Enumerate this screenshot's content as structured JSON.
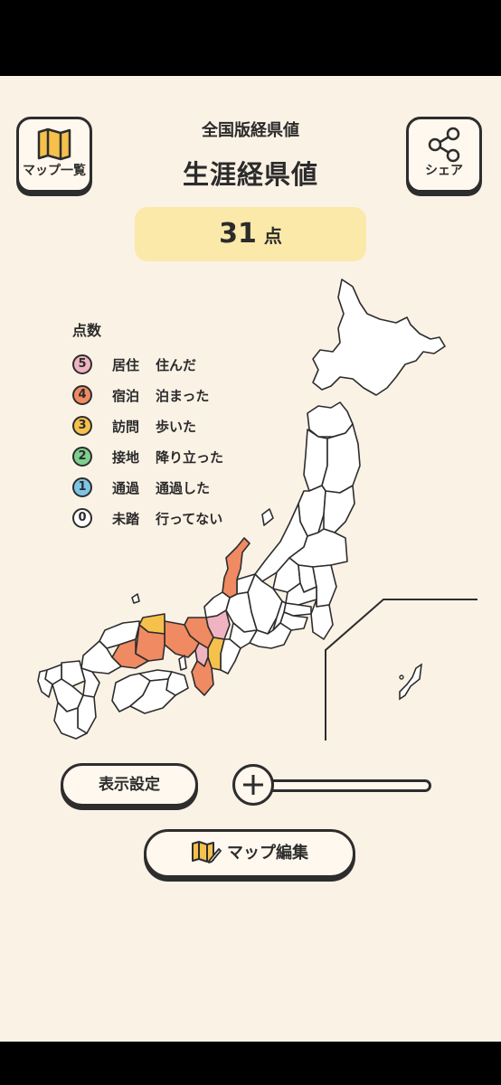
{
  "header": {
    "map_list_label": "マップ一覧",
    "share_label": "シェア",
    "subtitle": "全国版経県値",
    "title": "生涯経県値"
  },
  "score": {
    "value": "31",
    "unit": "点"
  },
  "legend": {
    "title": "点数",
    "levels": [
      {
        "score": "5",
        "name": "居住",
        "desc": "住んだ",
        "color": "#f0b3c2"
      },
      {
        "score": "4",
        "name": "宿泊",
        "desc": "泊まった",
        "color": "#f08a62"
      },
      {
        "score": "3",
        "name": "訪問",
        "desc": "歩いた",
        "color": "#f5c14c"
      },
      {
        "score": "2",
        "name": "接地",
        "desc": "降り立った",
        "color": "#7fcf8e"
      },
      {
        "score": "1",
        "name": "通過",
        "desc": "通過した",
        "color": "#7ec4e4"
      },
      {
        "score": "0",
        "name": "未踏",
        "desc": "行ってない",
        "color": "#ffffff"
      }
    ]
  },
  "controls": {
    "display_settings_label": "表示設定",
    "map_edit_label": "マップ編集",
    "zoom_icon": "plus-icon"
  },
  "colors": {
    "background": "#fbf2e6",
    "score_box": "#fbe9a9",
    "outline": "#2d2d2d"
  }
}
